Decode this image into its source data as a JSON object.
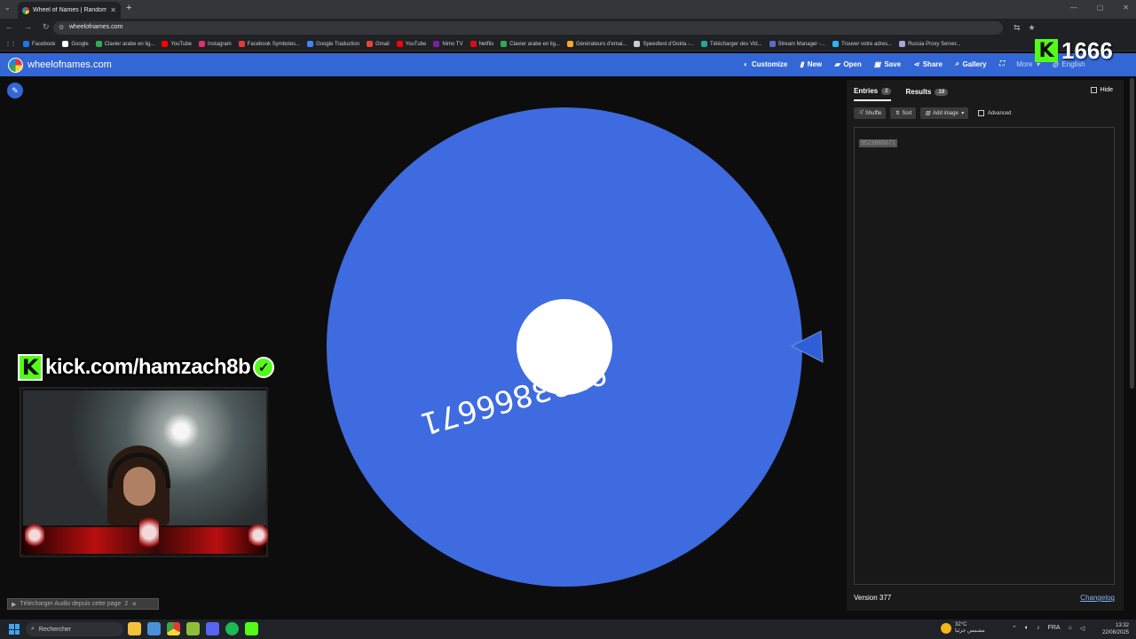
{
  "browser": {
    "tab_title": "Wheel of Names | Random nam",
    "url": "wheelofnames.com",
    "bookmarks": [
      {
        "label": "Facebook",
        "color": "#1877f2"
      },
      {
        "label": "Google",
        "color": "#ffffff"
      },
      {
        "label": "Clavier arabe en lig...",
        "color": "#34a853"
      },
      {
        "label": "YouTube",
        "color": "#ff0000"
      },
      {
        "label": "Instagram",
        "color": "#e1306c"
      },
      {
        "label": "Facebook Symboles...",
        "color": "#e53935"
      },
      {
        "label": "Google Traduction",
        "color": "#4285f4"
      },
      {
        "label": "Gmail",
        "color": "#ea4335"
      },
      {
        "label": "YouTube",
        "color": "#ff0000"
      },
      {
        "label": "Nimo TV",
        "color": "#7b1fa2"
      },
      {
        "label": "Netflix",
        "color": "#e50914"
      },
      {
        "label": "Clavier arabe en lig...",
        "color": "#34a853"
      },
      {
        "label": "Générateurs d'emai...",
        "color": "#f9a825"
      },
      {
        "label": "Speedtest d'Ookla -...",
        "color": "#cccccc"
      },
      {
        "label": "Télécharger des Vid...",
        "color": "#26a69a"
      },
      {
        "label": "Stream Manager -...",
        "color": "#5c6bc0"
      },
      {
        "label": "Trouver votre adres...",
        "color": "#29b6f6"
      },
      {
        "label": "Russia Proxy Server...",
        "color": "#9fa8da"
      }
    ]
  },
  "app": {
    "site_name": "wheelofnames.com",
    "nav": {
      "customize": "Customize",
      "new": "New",
      "open": "Open",
      "save": "Save",
      "share": "Share",
      "gallery": "Gallery",
      "more": "More",
      "language": "English"
    },
    "accent": "#3367d6"
  },
  "wheel": {
    "entry_text": "9523866671",
    "color": "#3f6be0"
  },
  "panel": {
    "entries_tab": "Entries",
    "entries_count": "1",
    "results_tab": "Results",
    "results_count": "18",
    "hide_label": "Hide",
    "shuffle": "Shuffle",
    "sort": "Sort",
    "add_image": "Add image",
    "advanced": "Advanced",
    "entries_text": "9523866671",
    "version": "Version 377",
    "changelog": "Changelog"
  },
  "overlay": {
    "kick_count": "1666",
    "kick_url": "kick.com/hamzach8b",
    "kick_color": "#53fc18"
  },
  "download_bar": {
    "text": "Télécharger Audio depuis cette page",
    "count": "2"
  },
  "taskbar": {
    "search_placeholder": "Rechercher",
    "temperature": "32°C",
    "weather_desc": "مشمس جزئيا",
    "language": "FRA",
    "time": "13:32",
    "date": "22/08/2025"
  }
}
